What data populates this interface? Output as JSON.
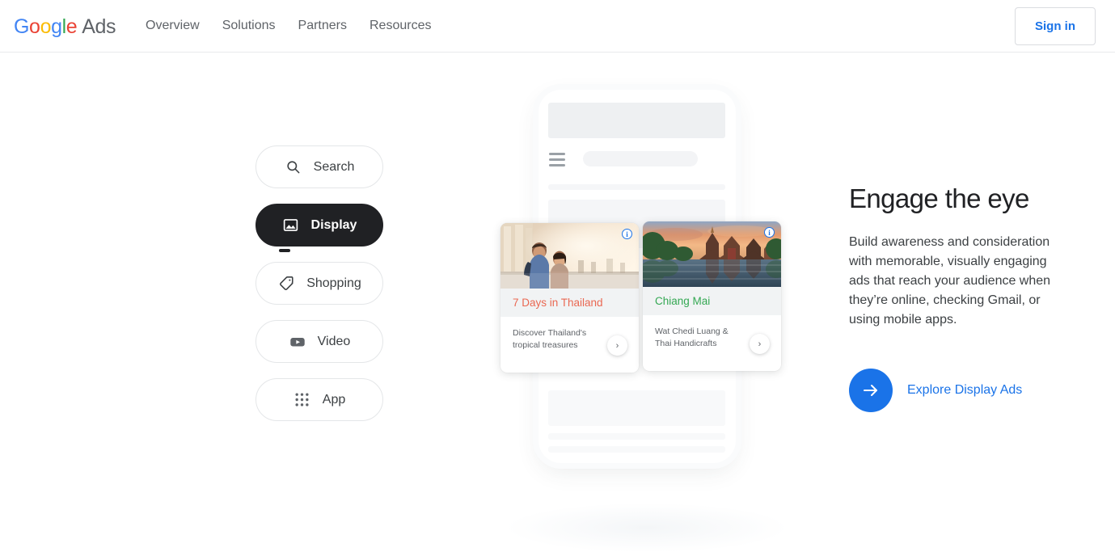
{
  "header": {
    "logo": {
      "google": "Google",
      "ads": "Ads"
    },
    "nav": [
      {
        "label": "Overview",
        "name": "nav-overview"
      },
      {
        "label": "Solutions",
        "name": "nav-solutions"
      },
      {
        "label": "Partners",
        "name": "nav-partners"
      },
      {
        "label": "Resources",
        "name": "nav-resources"
      }
    ],
    "signin_label": "Sign in"
  },
  "channel_pills": [
    {
      "label": "Search",
      "icon": "search-icon",
      "active": false
    },
    {
      "label": "Display",
      "icon": "image-icon",
      "active": true
    },
    {
      "label": "Shopping",
      "icon": "tag-icon",
      "active": false
    },
    {
      "label": "Video",
      "icon": "youtube-icon",
      "active": false
    },
    {
      "label": "App",
      "icon": "grid-dots-icon",
      "active": false
    }
  ],
  "phone_preview": {
    "ad_cards": [
      {
        "title": "7 Days in Thailand",
        "title_color": "#ea6852",
        "description": "Discover Thailand's tropical treasures",
        "badge": "i",
        "chevron": "›",
        "photo": "couple-at-temple-photo"
      },
      {
        "title": "Chiang Mai",
        "title_color": "#34a853",
        "description": "Wat Chedi Luang & Thai Handicrafts",
        "badge": "i",
        "chevron": "›",
        "photo": "temple-at-sunset-photo"
      }
    ]
  },
  "hero": {
    "heading": "Engage the eye",
    "body": "Build awareness and consideration with memorable, visually engaging ads that reach your audience when they’re online, checking Gmail, or using mobile apps.",
    "cta_label": "Explore Display Ads",
    "cta_icon": "arrow-right-icon"
  },
  "colors": {
    "accent_blue": "#1a73e8",
    "active_pill": "#202124",
    "text_primary": "#202124",
    "text_secondary": "#5f6368"
  }
}
